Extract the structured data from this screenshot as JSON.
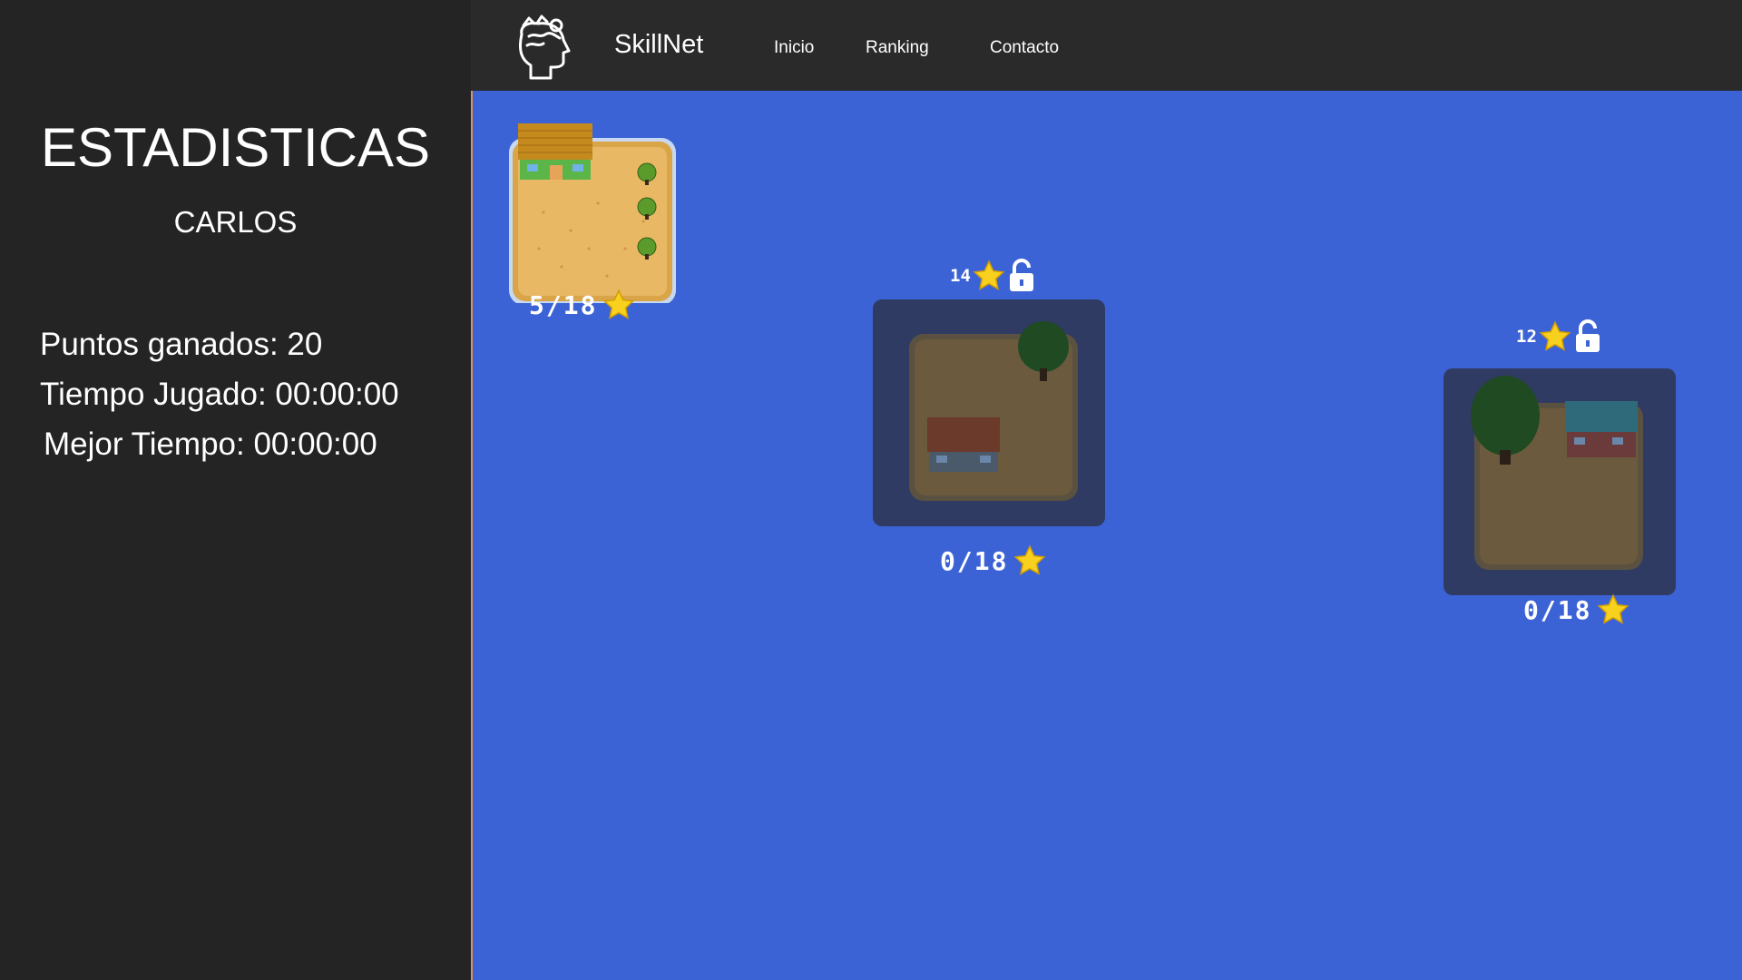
{
  "app": {
    "brand": "SkillNet"
  },
  "nav": {
    "items": [
      "Inicio",
      "Ranking",
      "Contacto"
    ]
  },
  "sidebar": {
    "title": "ESTADISTICAS",
    "username": "CARLOS",
    "stats": [
      "Puntos ganados: 20",
      "Tiempo Jugado: 00:00:00",
      "Mejor Tiempo: 00:00:00"
    ]
  },
  "levels": [
    {
      "score": "5/18",
      "unlocked": true
    },
    {
      "score": "0/18",
      "unlocked": false,
      "required": "14"
    },
    {
      "score": "0/18",
      "unlocked": false,
      "required": "12"
    }
  ],
  "colors": {
    "sidebar": "#242424",
    "topbar": "#2a2a2a",
    "map": "#3c63d5",
    "star": "#f7d11e",
    "locked_tile": "#2f3b62"
  },
  "icons": [
    "brain-head-icon",
    "star-icon",
    "lock-icon"
  ]
}
